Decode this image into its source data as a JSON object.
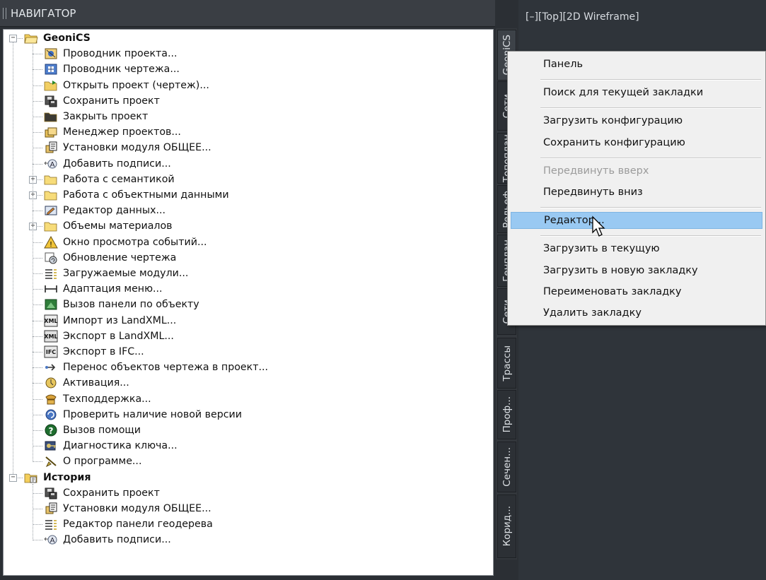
{
  "navigator": {
    "title": "НАВИГАТОР",
    "tree": [
      {
        "label": "GeoniCS",
        "icon": "folder-open-icon",
        "level": 0,
        "expander": "minus"
      },
      {
        "label": "Проводник проекта...",
        "icon": "project-explorer-icon",
        "level": 1
      },
      {
        "label": "Проводник чертежа...",
        "icon": "drawing-explorer-icon",
        "level": 1
      },
      {
        "label": "Открыть проект (чертеж)...",
        "icon": "open-folder-icon",
        "level": 1
      },
      {
        "label": "Сохранить проект",
        "icon": "save-icon",
        "level": 1
      },
      {
        "label": "Закрыть проект",
        "icon": "close-folder-icon",
        "level": 1
      },
      {
        "label": "Менеджер проектов...",
        "icon": "project-manager-icon",
        "level": 1
      },
      {
        "label": "Установки модуля ОБЩЕЕ...",
        "icon": "settings-icon",
        "level": 1
      },
      {
        "label": "Добавить подписи...",
        "icon": "add-label-icon",
        "level": 1
      },
      {
        "label": "Работа с семантикой",
        "icon": "folder-icon",
        "level": 1,
        "expander": "plus"
      },
      {
        "label": "Работа с объектными данными",
        "icon": "folder-icon",
        "level": 1,
        "expander": "plus"
      },
      {
        "label": "Редактор данных...",
        "icon": "data-editor-icon",
        "level": 1
      },
      {
        "label": "Объемы материалов",
        "icon": "folder-icon",
        "level": 1,
        "expander": "plus"
      },
      {
        "label": "Окно просмотра событий...",
        "icon": "warning-icon",
        "level": 1
      },
      {
        "label": "Обновление чертежа",
        "icon": "refresh-drawing-icon",
        "level": 1
      },
      {
        "label": "Загружаемые модули...",
        "icon": "list-icon",
        "level": 1
      },
      {
        "label": "Адаптация меню...",
        "icon": "menu-adapt-icon",
        "level": 1
      },
      {
        "label": "Вызов панели по объекту",
        "icon": "panel-call-icon",
        "level": 1
      },
      {
        "label": "Импорт из LandXML...",
        "icon": "xml-import-icon",
        "level": 1
      },
      {
        "label": "Экспорт в LandXML...",
        "icon": "xml-export-icon",
        "level": 1
      },
      {
        "label": "Экспорт в IFC...",
        "icon": "ifc-export-icon",
        "level": 1
      },
      {
        "label": "Перенос объектов чертежа в проект...",
        "icon": "transfer-icon",
        "level": 1
      },
      {
        "label": "Активация...",
        "icon": "activation-icon",
        "level": 1
      },
      {
        "label": "Техподдержка...",
        "icon": "phone-icon",
        "level": 1
      },
      {
        "label": "Проверить наличие новой версии",
        "icon": "update-check-icon",
        "level": 1
      },
      {
        "label": "Вызов помощи",
        "icon": "help-icon",
        "level": 1
      },
      {
        "label": "Диагностика ключа...",
        "icon": "key-diagnostics-icon",
        "level": 1
      },
      {
        "label": "О программе...",
        "icon": "about-icon",
        "level": 1
      },
      {
        "label": "История",
        "icon": "history-folder-icon",
        "level": 0,
        "expander": "minus"
      },
      {
        "label": "Сохранить проект",
        "icon": "save-icon",
        "level": 1
      },
      {
        "label": "Установки модуля ОБЩЕЕ...",
        "icon": "settings-icon",
        "level": 1
      },
      {
        "label": "Редактор панели геодерева",
        "icon": "list-icon",
        "level": 1
      },
      {
        "label": "Добавить подписи...",
        "icon": "add-label-icon",
        "level": 1
      }
    ]
  },
  "vertical_tabs": [
    {
      "label": "GeoniCS",
      "active": true
    },
    {
      "label": "Сети",
      "active": false
    },
    {
      "label": "Топоплан",
      "active": false
    },
    {
      "label": "Рельеф",
      "active": false
    },
    {
      "label": "Генплан",
      "active": false
    },
    {
      "label": "Сети",
      "active": false
    },
    {
      "label": "Трассы",
      "active": false
    },
    {
      "label": "Проф...",
      "active": false
    },
    {
      "label": "Сечен...",
      "active": false
    },
    {
      "label": "Корид...",
      "active": false
    }
  ],
  "viewport": {
    "label": "[–][Top][2D Wireframe]"
  },
  "context_menu": {
    "items": [
      {
        "label": "Панель",
        "state": "normal"
      },
      {
        "separator": true
      },
      {
        "label": "Поиск для текущей закладки",
        "state": "normal"
      },
      {
        "separator": true
      },
      {
        "label": "Загрузить конфигурацию",
        "state": "normal"
      },
      {
        "label": "Сохранить конфигурацию",
        "state": "normal"
      },
      {
        "separator": true
      },
      {
        "label": "Передвинуть вверх",
        "state": "disabled"
      },
      {
        "label": "Передвинуть вниз",
        "state": "normal"
      },
      {
        "separator": true
      },
      {
        "label": "Редактор...",
        "state": "highlighted"
      },
      {
        "separator": true
      },
      {
        "label": "Загрузить в текущую",
        "state": "normal"
      },
      {
        "label": "Загрузить в новую закладку",
        "state": "normal"
      },
      {
        "label": "Переименовать закладку",
        "state": "normal"
      },
      {
        "label": "Удалить закладку",
        "state": "normal"
      }
    ]
  },
  "colors": {
    "panel_bg": "#3a3e44",
    "tree_bg": "#ffffff",
    "menu_bg": "#f0f0f0",
    "menu_highlight": "#99c9f2",
    "viewport_bg": "#2f343a"
  }
}
